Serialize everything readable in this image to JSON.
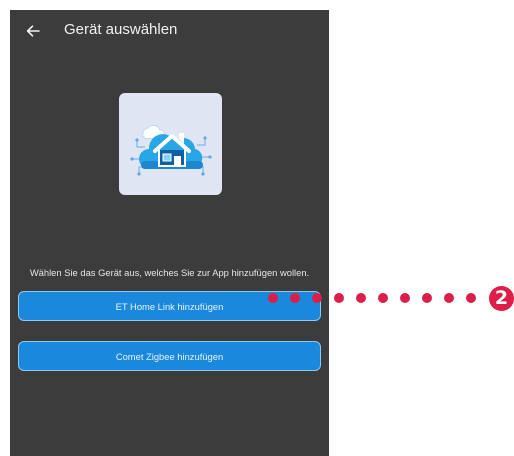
{
  "header": {
    "title": "Gerät auswählen",
    "back_icon": "arrow-left-icon"
  },
  "device_image": {
    "icon": "smart-home-cloud-icon"
  },
  "prompt": "Wählen Sie das Gerät aus, welches Sie zur App hinzufügen wollen.",
  "buttons": {
    "et_home_link": "ET Home Link hinzufügen",
    "comet_zigbee": "Comet Zigbee hinzufügen"
  },
  "annotation": {
    "number": "2"
  },
  "colors": {
    "screen_background": "#3c3c3c",
    "button_fill": "#1a88dc",
    "button_border": "#8ec8f0",
    "annotation": "#dd1e48",
    "image_tile": "#dfe5f3"
  }
}
